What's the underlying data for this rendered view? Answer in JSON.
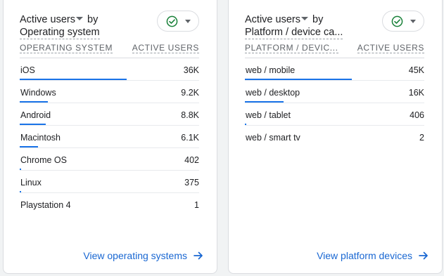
{
  "cards": [
    {
      "title_metric": "Active users",
      "title_by": "by",
      "title_dimension": "Operating system",
      "col_dimension": "Operating system",
      "col_metric": "Active users",
      "rows": [
        {
          "label": "iOS",
          "value": "36K",
          "share": 1.0
        },
        {
          "label": "Windows",
          "value": "9.2K",
          "share": 0.26
        },
        {
          "label": "Android",
          "value": "8.8K",
          "share": 0.245
        },
        {
          "label": "Macintosh",
          "value": "6.1K",
          "share": 0.17
        },
        {
          "label": "Chrome OS",
          "value": "402",
          "share": 0.012
        },
        {
          "label": "Linux",
          "value": "375",
          "share": 0.011
        },
        {
          "label": "Playstation 4",
          "value": "1",
          "share": 0.0
        }
      ],
      "link_label": "View operating systems"
    },
    {
      "title_metric": "Active users",
      "title_by": "by",
      "title_dimension": "Platform / device ca...",
      "col_dimension": "Platform / devic...",
      "col_metric": "Active users",
      "rows": [
        {
          "label": "web / mobile",
          "value": "45K",
          "share": 1.0
        },
        {
          "label": "web / desktop",
          "value": "16K",
          "share": 0.36
        },
        {
          "label": "web / tablet",
          "value": "406",
          "share": 0.009
        },
        {
          "label": "web / smart tv",
          "value": "2",
          "share": 0.0
        }
      ],
      "link_label": "View platform devices"
    }
  ],
  "colors": {
    "accent": "#1a73e8",
    "link": "#1967d2",
    "check": "#188038"
  },
  "icons": {
    "status": "check-circle-icon",
    "menu": "caret-down-icon",
    "link": "arrow-right-icon"
  }
}
